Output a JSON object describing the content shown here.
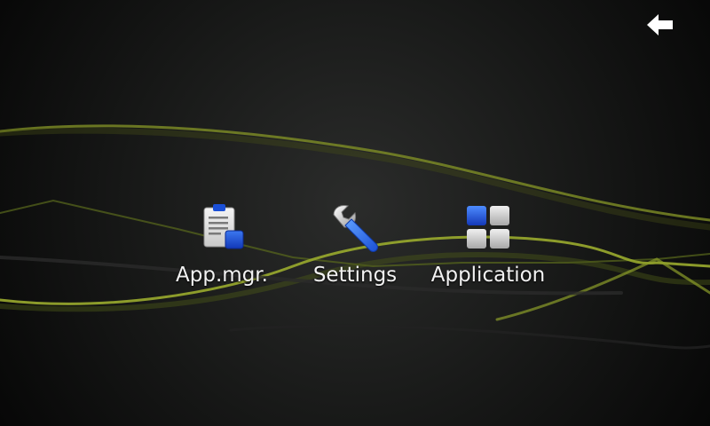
{
  "background": {
    "base_color": "#060606",
    "vignette_color": "#2b2c2b",
    "wave_color": "#8a9a2a"
  },
  "header": {
    "back_icon": "back-arrow-icon"
  },
  "launcher": {
    "items": [
      {
        "label": "App.mgr.",
        "icon": "clipboard-icon",
        "accent": "#1a4fd6"
      },
      {
        "label": "Settings",
        "icon": "wrench-icon",
        "accent": "#2f78e8"
      },
      {
        "label": "Application",
        "icon": "app-grid-icon",
        "accent": "#1a4fd6"
      }
    ]
  }
}
